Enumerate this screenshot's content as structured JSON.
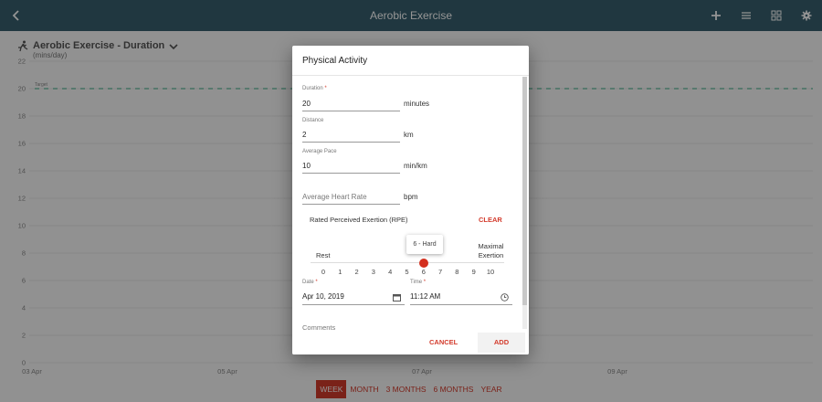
{
  "appbar": {
    "title": "Aerobic Exercise",
    "icons": [
      "chevron-left-icon",
      "plus-icon",
      "list-icon",
      "grid-icon",
      "gear-icon"
    ]
  },
  "chart": {
    "title": "Aerobic Exercise - Duration",
    "subtitle": "(mins/day)",
    "target_label": "Target",
    "target_color": "#5cb89a"
  },
  "chart_data": {
    "type": "line",
    "title": "Aerobic Exercise - Duration",
    "ylabel": "(mins/day)",
    "ylim": [
      0,
      22
    ],
    "yticks": [
      0,
      2,
      4,
      6,
      8,
      10,
      12,
      14,
      16,
      18,
      20,
      22
    ],
    "xticks": [
      "03 Apr",
      "05 Apr",
      "07 Apr",
      "09 Apr"
    ],
    "series": [
      {
        "name": "Target",
        "values": [
          20,
          20,
          20,
          20
        ]
      }
    ],
    "grid": true
  },
  "range": {
    "options": [
      "WEEK",
      "MONTH",
      "3 MONTHS",
      "6 MONTHS",
      "YEAR"
    ],
    "selected": "WEEK"
  },
  "dialog": {
    "title": "Physical Activity",
    "duration": {
      "label": "Duration",
      "required": "*",
      "value": "20",
      "unit": "minutes"
    },
    "distance": {
      "label": "Distance",
      "value": "2",
      "unit": "km"
    },
    "pace": {
      "label": "Average Pace",
      "value": "10",
      "unit": "min/km"
    },
    "heart_rate": {
      "placeholder": "Average Heart Rate",
      "unit": "bpm"
    },
    "rpe": {
      "label": "Rated Perceived Exertion (RPE)",
      "clear": "CLEAR",
      "min_label": "Rest",
      "max_label_1": "Maximal",
      "max_label_2": "Exertion",
      "ticks": [
        "0",
        "1",
        "2",
        "3",
        "4",
        "5",
        "6",
        "7",
        "8",
        "9",
        "10"
      ],
      "value": 6,
      "value_label": "6 - Hard"
    },
    "date": {
      "label": "Date",
      "required": "*",
      "value": "Apr 10, 2019"
    },
    "time": {
      "label": "Time",
      "required": "*",
      "value": "11:12 AM"
    },
    "comments": {
      "placeholder": "Comments"
    },
    "cancel": "CANCEL",
    "add": "ADD",
    "accent_color": "#d33b2c"
  }
}
